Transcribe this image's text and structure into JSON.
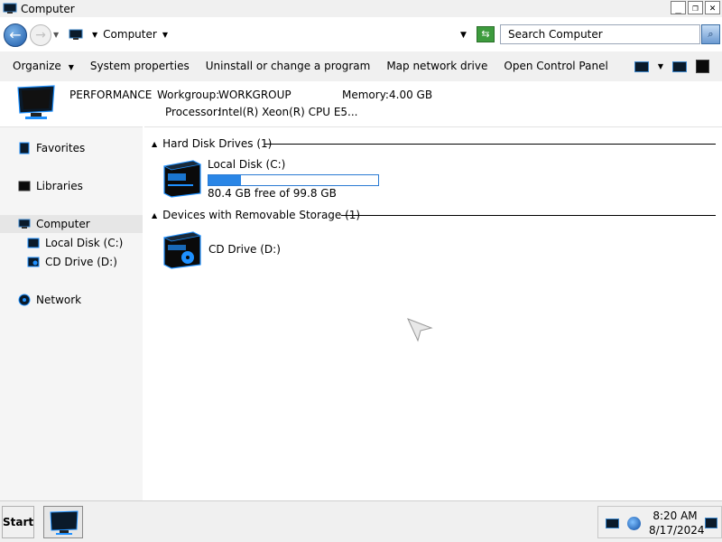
{
  "window": {
    "title": "Computer",
    "controls": {
      "minimize": "_",
      "restore": "❐",
      "close": "✕"
    }
  },
  "address": {
    "breadcrumb": "Computer",
    "search_placeholder": "Search Computer"
  },
  "toolbar": {
    "organize": "Organize",
    "system_properties": "System properties",
    "uninstall": "Uninstall or change a program",
    "map_network": "Map network drive",
    "open_control_panel": "Open Control Panel"
  },
  "details": {
    "computer_name": "PERFORMANCE",
    "workgroup_label": "Workgroup:",
    "workgroup_value": "WORKGROUP",
    "memory_label": "Memory:",
    "memory_value": "4.00 GB",
    "processor_label": "Processor:",
    "processor_value": "Intel(R) Xeon(R) CPU E5..."
  },
  "nav": {
    "favorites": "Favorites",
    "libraries": "Libraries",
    "computer": "Computer",
    "local_disk": "Local Disk (C:)",
    "cd_drive": "CD Drive (D:)",
    "network": "Network"
  },
  "content": {
    "hdd_group": "Hard Disk Drives (1)",
    "removable_group": "Devices with Removable Storage (1)",
    "local_disk": {
      "name": "Local Disk (C:)",
      "free_text": "80.4 GB free of 99.8 GB",
      "used_fraction": 0.19
    },
    "cd_drive": {
      "name": "CD Drive (D:)"
    }
  },
  "taskbar": {
    "start": "Start",
    "time": "8:20 AM",
    "date": "8/17/2024"
  },
  "colors": {
    "accent": "#2a86e6",
    "drive_blue": "#1e90ff"
  }
}
